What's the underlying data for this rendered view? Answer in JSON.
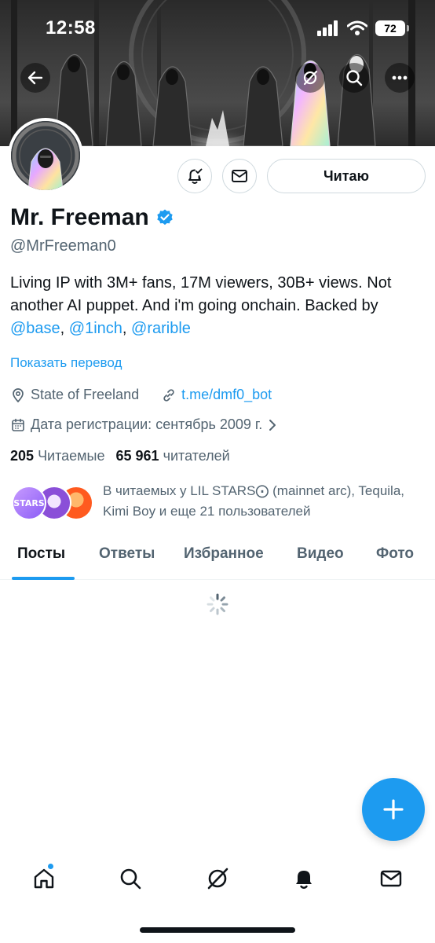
{
  "status_bar": {
    "time": "12:58",
    "battery": "72"
  },
  "profile": {
    "display_name": "Mr. Freeman",
    "handle": "@MrFreeman0",
    "follow_label": "Читаю",
    "bio_text": "Living IP with 3M+ fans, 17M viewers, 30B+ views. Not another AI puppet. And i'm going onchain. Backed by ",
    "bio_links": [
      "@base",
      "@1inch",
      "@rarible"
    ],
    "bio_sep": ", ",
    "translate_label": "Показать перевод",
    "location": "State of Freeland",
    "website": "t.me/dmf0_bot",
    "joined": "Дата регистрации: сентябрь 2009 г.",
    "following_count": "205",
    "following_label": "Читаемые",
    "followers_count": "65 961",
    "followers_label": "читателей",
    "known_followers_text": "В читаемых у LIL STARS⨀ (mainnet arc), Tequila, Kimi Boy и еще 21 пользователей",
    "mini_avatar_text": "STARS"
  },
  "tabs": [
    {
      "label": "Посты",
      "active": true
    },
    {
      "label": "Ответы",
      "active": false
    },
    {
      "label": "Избранное",
      "active": false
    },
    {
      "label": "Видео",
      "active": false
    },
    {
      "label": "Фото",
      "active": false
    }
  ],
  "icons": {
    "back": "arrow-left-icon",
    "grok": "grok-icon",
    "search": "search-icon",
    "more": "more-icon",
    "notify": "bell-plus-icon",
    "message": "envelope-icon",
    "verified": "verified-badge-icon",
    "location": "location-pin-icon",
    "link": "link-icon",
    "calendar": "calendar-icon",
    "compose": "plus-icon",
    "nav": [
      "home-icon",
      "search-icon",
      "grok-icon",
      "bell-icon",
      "mail-icon"
    ]
  },
  "colors": {
    "accent": "#1d9bf0",
    "secondary_text": "#536471",
    "primary_text": "#0f1419"
  }
}
